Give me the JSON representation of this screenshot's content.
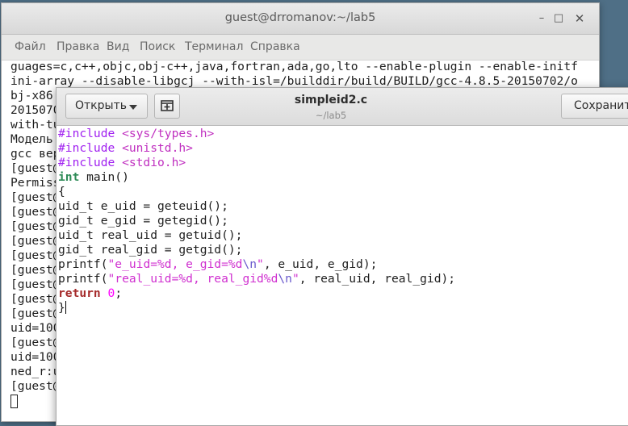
{
  "terminal": {
    "title": "guest@drromanov:~/lab5",
    "menu": [
      "Файл",
      "Правка",
      "Вид",
      "Поиск",
      "Терминал",
      "Справка"
    ],
    "lines": [
      "guages=c,c++,objc,obj-c++,java,fortran,ada,go,lto --enable-plugin --enable-initf",
      "ini-array --disable-libgcj --with-isl=/builddir/build/BUILD/gcc-4.8.5-20150702/o",
      "bj-x86",
      "2015070",
      "with-tu",
      "Модель",
      "gcc вер",
      "[guest@",
      "Permiss",
      "[guest@",
      "[guest@",
      "[guest@",
      "[guest@",
      "[guest@",
      "[guest@",
      "[guest@",
      "[guest@",
      "[guest@",
      "uid=100",
      "[guest@",
      "uid=100",
      "ned_r:u",
      "[guest@"
    ]
  },
  "editor": {
    "open_label": "Открыть",
    "save_label": "Сохранить",
    "filename": "simpleid2.c",
    "path": "~/lab5",
    "code": {
      "l1_pp": "#include ",
      "l1_inc": "<sys/types.h>",
      "l2_pp": "#include ",
      "l2_inc": "<unistd.h>",
      "l3_pp": "#include ",
      "l3_inc": "<stdio.h>",
      "l4_kw": "int",
      "l4_rest": " main()",
      "l5": "{",
      "l6": "uid_t e_uid = geteuid();",
      "l7": "gid_t e_gid = getegid();",
      "l8": "uid_t real_uid = getuid();",
      "l9": "gid_t real_gid = getgid();",
      "l10_a": "printf(",
      "l10_s1": "\"e_uid=%d, e_gid=%d",
      "l10_e": "\\n",
      "l10_s2": "\"",
      "l10_b": ", e_uid, e_gid);",
      "l11_a": "printf(",
      "l11_s1": "\"real_uid=%d, real_gid%d",
      "l11_e": "\\n",
      "l11_s2": "\"",
      "l11_b": ", real_uid, real_gid);",
      "l12_kw": "return",
      "l12_sp": " ",
      "l12_num": "0",
      "l12_end": ";",
      "l13": "}"
    }
  }
}
